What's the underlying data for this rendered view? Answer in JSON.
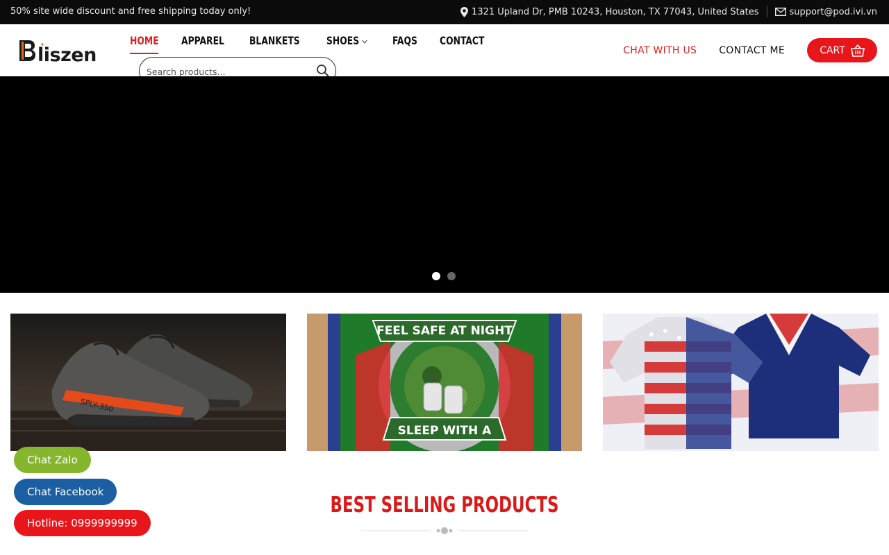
{
  "topbar": {
    "promo": "50% site wide discount and free shipping today only!",
    "address": "1321 Upland Dr, PMB 10243, Houston, TX 77043, United States",
    "email": "support@pod.ivi.vn",
    "icons": [
      "location-pin-icon",
      "envelope-icon"
    ]
  },
  "brand": {
    "name": "Bliszen"
  },
  "nav": {
    "items": [
      {
        "label": "HOME",
        "active": true
      },
      {
        "label": "APPAREL"
      },
      {
        "label": "BLANKETS"
      },
      {
        "label": "SHOES",
        "has_dropdown": true
      },
      {
        "label": "FAQS"
      },
      {
        "label": "CONTACT"
      }
    ]
  },
  "search": {
    "placeholder": "Search products..."
  },
  "header_right": {
    "chat_with_us": "CHAT WITH US",
    "contact_me": "CONTACT ME",
    "cart_label": "CART"
  },
  "slider": {
    "total_slides": 2,
    "active_slide": 1
  },
  "categories": [
    {
      "name": "shoes-tile"
    },
    {
      "name": "blanket-tile",
      "caption_top": "FEEL SAFE AT NIGHT",
      "caption_bottom": "SLEEP WITH A"
    },
    {
      "name": "apparel-tile"
    }
  ],
  "chat": {
    "zalo": "Chat Zalo",
    "facebook": "Chat Facebook",
    "hotline": "Hotline: 0999999999"
  },
  "section": {
    "best_selling_title": "BEST SELLING PRODUCTS"
  },
  "colors": {
    "accent": "#e02020",
    "cart": "#e8161b",
    "zalo": "#86b52e",
    "facebook": "#1b5fa2",
    "topbar": "#0b0b0b"
  }
}
